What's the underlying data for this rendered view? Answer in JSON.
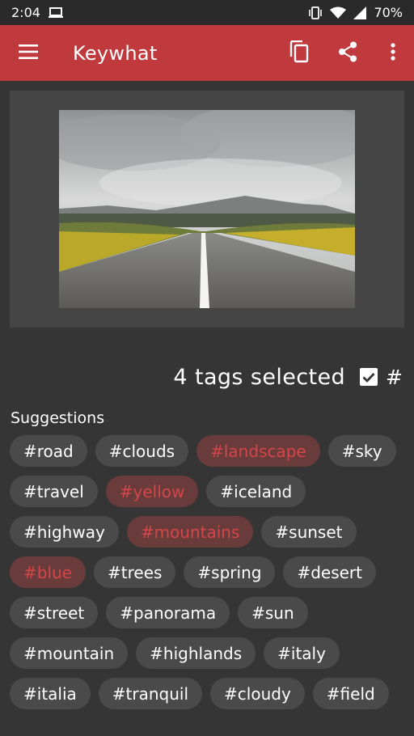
{
  "status_bar": {
    "time": "2:04",
    "battery": "70%",
    "icons": [
      "laptop-icon",
      "vibrate-icon",
      "wifi-icon",
      "signal-icon",
      "battery-icon"
    ]
  },
  "toolbar": {
    "title": "Keywhat",
    "icons": [
      "menu-icon",
      "copy-icon",
      "share-icon",
      "more-vert-icon"
    ],
    "color": "#c0393d"
  },
  "image": {
    "description_icon": "road-landscape-photo"
  },
  "selection": {
    "count_text": "4 tags selected",
    "hash_checked": true,
    "hash_label": "#"
  },
  "suggestions": {
    "label": "Suggestions",
    "tags": [
      {
        "text": "#road",
        "selected": false
      },
      {
        "text": "#clouds",
        "selected": false
      },
      {
        "text": "#landscape",
        "selected": true
      },
      {
        "text": "#sky",
        "selected": false
      },
      {
        "text": "#travel",
        "selected": false
      },
      {
        "text": "#yellow",
        "selected": true
      },
      {
        "text": "#iceland",
        "selected": false
      },
      {
        "text": "#highway",
        "selected": false
      },
      {
        "text": "#mountains",
        "selected": true
      },
      {
        "text": "#sunset",
        "selected": false
      },
      {
        "text": "#blue",
        "selected": true
      },
      {
        "text": "#trees",
        "selected": false
      },
      {
        "text": "#spring",
        "selected": false
      },
      {
        "text": "#desert",
        "selected": false
      },
      {
        "text": "#street",
        "selected": false
      },
      {
        "text": "#panorama",
        "selected": false
      },
      {
        "text": "#sun",
        "selected": false
      },
      {
        "text": "#mountain",
        "selected": false
      },
      {
        "text": "#highlands",
        "selected": false
      },
      {
        "text": "#italy",
        "selected": false
      },
      {
        "text": "#italia",
        "selected": false
      },
      {
        "text": "#tranquil",
        "selected": false
      },
      {
        "text": "#cloudy",
        "selected": false
      },
      {
        "text": "#field",
        "selected": false
      }
    ]
  },
  "colors": {
    "background": "#353535",
    "chip": "#4a4a4a",
    "chip_selected_bg": "#6a3b3b",
    "chip_selected_text": "#d3464a"
  }
}
